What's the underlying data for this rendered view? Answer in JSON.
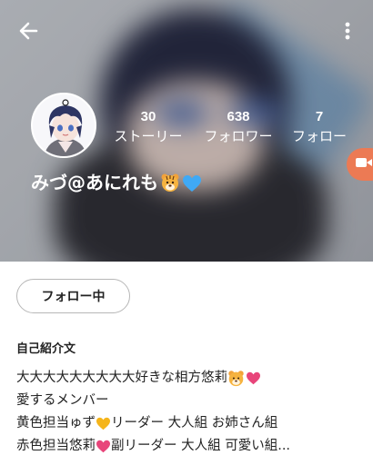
{
  "header": {
    "back_icon": "arrow-left-icon",
    "more_icon": "more-vertical-icon"
  },
  "profile": {
    "username": "みづ@あにれも",
    "username_emojis": [
      "tiger-face-emoji",
      "blue-heart-emoji"
    ],
    "stats": [
      {
        "value": "30",
        "label": "ストーリー"
      },
      {
        "value": "638",
        "label": "フォロワー"
      },
      {
        "value": "7",
        "label": "フォロー"
      }
    ],
    "live_icon": "video-camera-icon"
  },
  "actions": {
    "follow_label": "フォロー中"
  },
  "bio": {
    "title": "自己紹介文",
    "lines": [
      {
        "text": "大大大大大大大大大好きな相方悠莉",
        "emojis": [
          "tiger-face-emoji",
          "pink-heart-emoji"
        ]
      },
      {
        "text": "愛するメンバー"
      },
      {
        "parts": [
          "黄色担当ゅず",
          "リーダー 大人組 お姉さん組"
        ],
        "emoji": "yellow-heart-emoji"
      },
      {
        "parts": [
          "赤色担当悠莉",
          "副リーダー 大人組 可愛い組..."
        ],
        "emoji": "pink-heart-emoji"
      }
    ]
  },
  "colors": {
    "live_button": "#ec7a54",
    "heart_blue": "#3fa9f5",
    "heart_pink": "#e8457a",
    "heart_yellow": "#f5b51b"
  }
}
